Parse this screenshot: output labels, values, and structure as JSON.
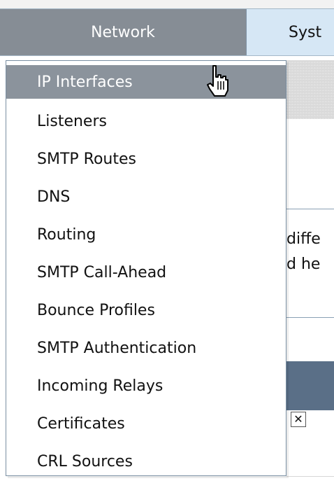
{
  "tabs": [
    {
      "label": "Network",
      "active": true
    },
    {
      "label": "Syst",
      "active": false
    }
  ],
  "menu": {
    "items": [
      {
        "label": "IP Interfaces",
        "active": true
      },
      {
        "label": "Listeners",
        "active": false
      },
      {
        "label": "SMTP Routes",
        "active": false
      },
      {
        "label": "DNS",
        "active": false
      },
      {
        "label": "Routing",
        "active": false
      },
      {
        "label": "SMTP Call-Ahead",
        "active": false
      },
      {
        "label": "Bounce Profiles",
        "active": false
      },
      {
        "label": "SMTP Authentication",
        "active": false
      },
      {
        "label": "Incoming Relays",
        "active": false
      },
      {
        "label": "Certificates",
        "active": false
      },
      {
        "label": "CRL Sources",
        "active": false
      }
    ]
  },
  "background": {
    "partial_text_line1": "diffe",
    "partial_text_line2": "d he"
  },
  "colors": {
    "accent": "#868d95",
    "tabbar": "#cfe2f3",
    "menu_active": "#8b939c",
    "header_bar": "#5a6f87"
  },
  "icons": {
    "cursor": "hand-pointer-icon",
    "checkbox": "checkbox-x-icon"
  }
}
